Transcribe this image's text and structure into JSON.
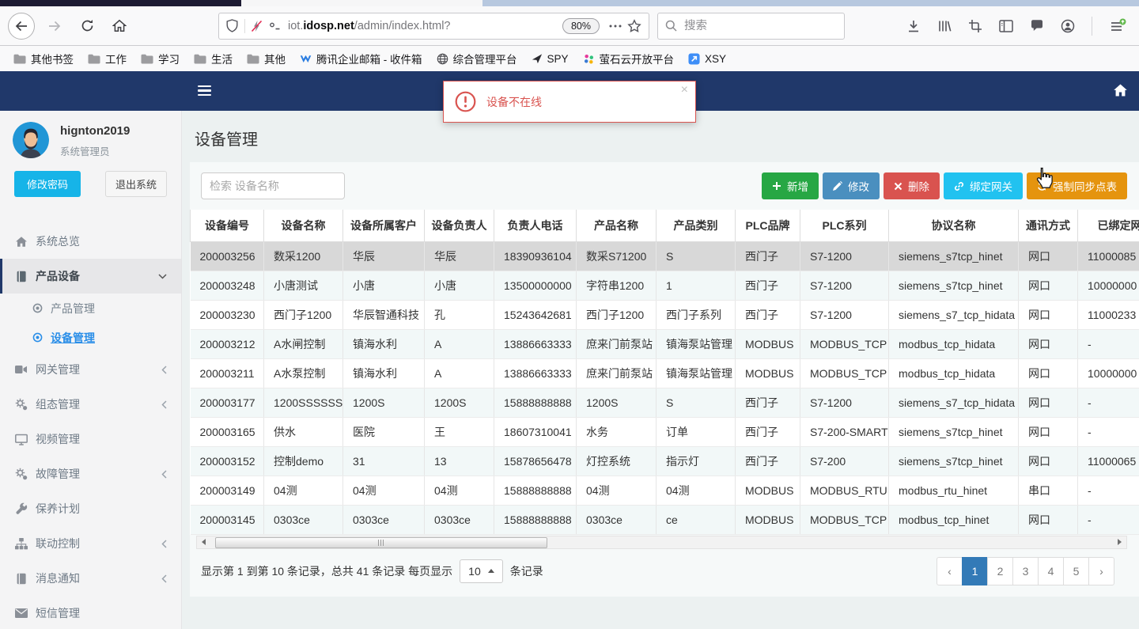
{
  "browser": {
    "toolbar": {
      "url": {
        "subdomain": "iot.",
        "domain": "idosp.net",
        "path": "/admin/index.html?"
      },
      "zoom_badge": "80%",
      "search_placeholder": "搜索"
    },
    "bookmarks": [
      {
        "icon": "folder-icon",
        "label": "其他书签"
      },
      {
        "icon": "folder-icon",
        "label": "工作"
      },
      {
        "icon": "folder-icon",
        "label": "学习"
      },
      {
        "icon": "folder-icon",
        "label": "生活"
      },
      {
        "icon": "folder-icon",
        "label": "其他"
      },
      {
        "icon": "tencent-mail-icon",
        "label": "腾讯企业邮箱 - 收件箱"
      },
      {
        "icon": "globe-icon",
        "label": "综合管理平台"
      },
      {
        "icon": "dart-icon",
        "label": "SPY"
      },
      {
        "icon": "dots-icon",
        "label": "萤石云开放平台"
      },
      {
        "icon": "arrow-square-icon",
        "label": "XSY"
      }
    ]
  },
  "app": {
    "alert": {
      "text": "设备不在线"
    },
    "sidebar": {
      "user": {
        "name": "hignton2019",
        "role": "系统管理员"
      },
      "change_password": "修改密码",
      "logout": "退出系统",
      "menu": [
        {
          "icon": "home-icon",
          "label": "系统总览"
        },
        {
          "icon": "book-icon",
          "label": "产品设备",
          "chevron": "down",
          "active": true,
          "submenu": [
            {
              "icon": "dot-circle-icon",
              "label": "产品管理",
              "active": false
            },
            {
              "icon": "dot-circle-icon",
              "label": "设备管理",
              "active": true
            }
          ]
        },
        {
          "icon": "video-icon",
          "label": "网关管理",
          "chevron": "left"
        },
        {
          "icon": "gears-icon",
          "label": "组态管理",
          "chevron": "left"
        },
        {
          "icon": "monitor-icon",
          "label": "视频管理"
        },
        {
          "icon": "gears-icon",
          "label": "故障管理",
          "chevron": "left"
        },
        {
          "icon": "wrench-icon",
          "label": "保养计划"
        },
        {
          "icon": "sitemap-icon",
          "label": "联动控制",
          "chevron": "left"
        },
        {
          "icon": "book-icon",
          "label": "消息通知",
          "chevron": "left"
        },
        {
          "icon": "envelope-icon",
          "label": "短信管理"
        }
      ]
    },
    "main": {
      "title": "设备管理",
      "search_placeholder": "检索 设备名称",
      "actions": {
        "add": "新增",
        "edit": "修改",
        "delete": "删除",
        "bind": "绑定网关",
        "sync": "强制同步点表"
      },
      "table": {
        "headers": [
          "设备编号",
          "设备名称",
          "设备所属客户",
          "设备负责人",
          "负责人电话",
          "产品名称",
          "产品类别",
          "PLC品牌",
          "PLC系列",
          "协议名称",
          "通讯方式",
          "已绑定网关"
        ],
        "selected_row_index": 0,
        "rows": [
          [
            "200003256",
            "数采1200",
            "华辰",
            "华辰",
            "18390936104",
            "数采S71200",
            "S",
            "西门子",
            "S7-1200",
            "siemens_s7tcp_hinet",
            "网口",
            "11000085"
          ],
          [
            "200003248",
            "小唐测试",
            "小唐",
            "小唐",
            "13500000000",
            "字符串1200",
            "1",
            "西门子",
            "S7-1200",
            "siemens_s7tcp_hinet",
            "网口",
            "10000000"
          ],
          [
            "200003230",
            "西门子1200",
            "华辰智通科技",
            "孔",
            "15243642681",
            "西门子1200",
            "西门子系列",
            "西门子",
            "S7-1200",
            "siemens_s7_tcp_hidata",
            "网口",
            "11000233"
          ],
          [
            "200003212",
            "A水闸控制",
            "镇海水利",
            "A",
            "13886663333",
            "庶来门前泵站",
            "镇海泵站管理",
            "MODBUS",
            "MODBUS_TCP",
            "modbus_tcp_hidata",
            "网口",
            "-"
          ],
          [
            "200003211",
            "A水泵控制",
            "镇海水利",
            "A",
            "13886663333",
            "庶来门前泵站",
            "镇海泵站管理",
            "MODBUS",
            "MODBUS_TCP",
            "modbus_tcp_hidata",
            "网口",
            "10000000"
          ],
          [
            "200003177",
            "1200SSSSSS",
            "1200S",
            "1200S",
            "15888888888",
            "1200S",
            "S",
            "西门子",
            "S7-1200",
            "siemens_s7_tcp_hidata",
            "网口",
            "-"
          ],
          [
            "200003165",
            "供水",
            "医院",
            "王",
            "18607310041",
            "水务",
            "订单",
            "西门子",
            "S7-200-SMART",
            "siemens_s7tcp_hinet",
            "网口",
            "-"
          ],
          [
            "200003152",
            "控制demo",
            "31",
            "13",
            "15878656478",
            "灯控系统",
            "指示灯",
            "西门子",
            "S7-200",
            "siemens_s7tcp_hinet",
            "网口",
            "11000065"
          ],
          [
            "200003149",
            "04测",
            "04测",
            "04测",
            "15888888888",
            "04测",
            "04测",
            "MODBUS",
            "MODBUS_RTU",
            "modbus_rtu_hinet",
            "串口",
            "-"
          ],
          [
            "200003145",
            "0303ce",
            "0303ce",
            "0303ce",
            "15888888888",
            "0303ce",
            "ce",
            "MODBUS",
            "MODBUS_TCP",
            "modbus_tcp_hinet",
            "网口",
            "-"
          ]
        ]
      },
      "pagination": {
        "summary_prefix": "显示第 1 到第 10 条记录，总共 41 条记录 每页显示",
        "page_size": "10",
        "summary_suffix": "条记录",
        "prev": "‹",
        "next": "›",
        "pages": [
          "1",
          "2",
          "3",
          "4",
          "5"
        ],
        "active_page": "1"
      }
    }
  }
}
